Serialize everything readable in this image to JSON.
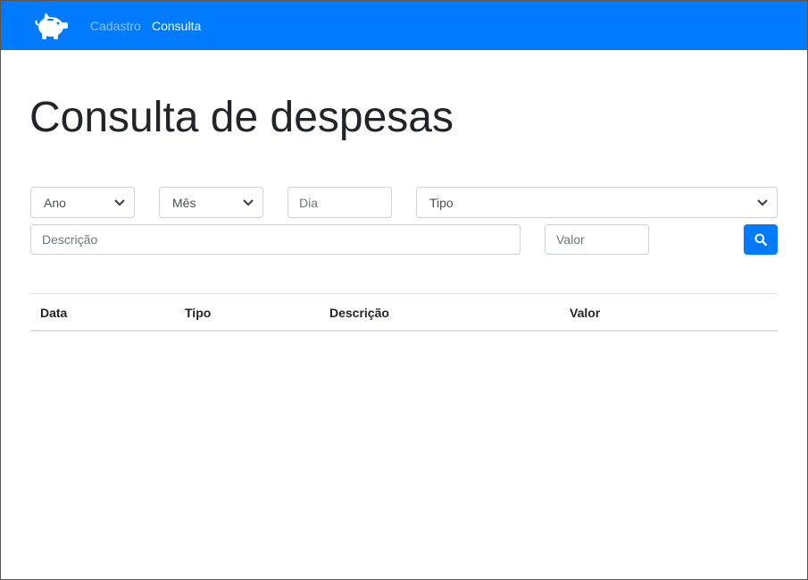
{
  "navbar": {
    "brand_icon": "piggy-bank-icon",
    "links": [
      {
        "label": "Cadastro",
        "active": false
      },
      {
        "label": "Consulta",
        "active": true
      }
    ],
    "background": "#007bff"
  },
  "page": {
    "title": "Consulta de despesas"
  },
  "filters": {
    "ano": {
      "placeholder": "Ano"
    },
    "mes": {
      "placeholder": "Mês"
    },
    "dia": {
      "placeholder": "Dia"
    },
    "tipo": {
      "placeholder": "Tipo"
    },
    "descricao": {
      "placeholder": "Descrição"
    },
    "valor": {
      "placeholder": "Valor"
    },
    "search_icon": "search-icon"
  },
  "table": {
    "headers": [
      "Data",
      "Tipo",
      "Descrição",
      "Valor"
    ],
    "rows": []
  }
}
